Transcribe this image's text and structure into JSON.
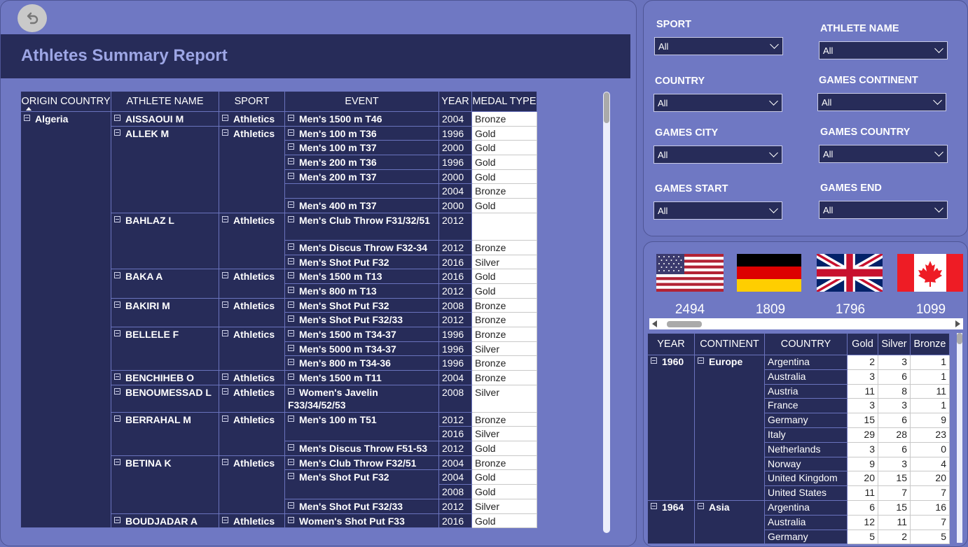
{
  "report": {
    "title": "Athletes Summary Report"
  },
  "athletes_table": {
    "columns": [
      "ORIGIN COUNTRY",
      "ATHLETE NAME",
      "SPORT",
      "EVENT",
      "YEAR",
      "MEDAL TYPE"
    ],
    "country": "Algeria",
    "groups": [
      {
        "name": "AISSAOUI M",
        "sport": "Athletics",
        "rows": [
          {
            "event": "Men's 1500 m T46",
            "year": "2004",
            "medal": "Bronze"
          }
        ]
      },
      {
        "name": "ALLEK M",
        "sport": "Athletics",
        "rows": [
          {
            "event": "Men's 100 m T36",
            "year": "1996",
            "medal": "Gold"
          },
          {
            "event": "Men's 100 m T37",
            "year": "2000",
            "medal": "Gold"
          },
          {
            "event": "Men's 200 m T36",
            "year": "1996",
            "medal": "Gold"
          },
          {
            "event": "Men's 200 m T37",
            "year": "2000",
            "medal": "Gold"
          },
          {
            "event": "",
            "year": "2004",
            "medal": "Bronze"
          },
          {
            "event": "Men's 400 m T37",
            "year": "2000",
            "medal": "Gold"
          }
        ]
      },
      {
        "name": "BAHLAZ L",
        "sport": "Athletics",
        "rows": [
          {
            "event": "Men's Club Throw F31/32/51",
            "year": "2012",
            "medal": "",
            "tall": true
          },
          {
            "event": "Men's Discus Throw F32-34",
            "year": "2012",
            "medal": "Bronze"
          },
          {
            "event": "Men's Shot Put F32",
            "year": "2016",
            "medal": "Silver"
          }
        ]
      },
      {
        "name": "BAKA A",
        "sport": "Athletics",
        "rows": [
          {
            "event": "Men's 1500 m T13",
            "year": "2016",
            "medal": "Gold"
          },
          {
            "event": "Men's 800 m T13",
            "year": "2012",
            "medal": "Gold"
          }
        ]
      },
      {
        "name": "BAKIRI M",
        "sport": "Athletics",
        "rows": [
          {
            "event": "Men's Shot Put F32",
            "year": "2008",
            "medal": "Bronze"
          },
          {
            "event": "Men's Shot Put F32/33",
            "year": "2012",
            "medal": "Bronze"
          }
        ]
      },
      {
        "name": "BELLELE F",
        "sport": "Athletics",
        "rows": [
          {
            "event": "Men's 1500 m T34-37",
            "year": "1996",
            "medal": "Bronze"
          },
          {
            "event": "Men's 5000 m T34-37",
            "year": "1996",
            "medal": "Silver"
          },
          {
            "event": "Men's 800 m T34-36",
            "year": "1996",
            "medal": "Bronze"
          }
        ]
      },
      {
        "name": "BENCHIHEB O",
        "sport": "Athletics",
        "rows": [
          {
            "event": "Men's 1500 m T11",
            "year": "2004",
            "medal": "Bronze"
          }
        ]
      },
      {
        "name": "BENOUMESSAD L",
        "sport": "Athletics",
        "rows": [
          {
            "event": "Women's Javelin F33/34/52/53",
            "year": "2008",
            "medal": "Silver",
            "tall": true
          }
        ]
      },
      {
        "name": "BERRAHAL M",
        "sport": "Athletics",
        "rows": [
          {
            "event": "Men's 100 m T51",
            "year": "2012",
            "medal": "Bronze",
            "span": 2
          },
          {
            "event": null,
            "year": "2016",
            "medal": "Silver"
          },
          {
            "event": "Men's Discus Throw F51-53",
            "year": "2012",
            "medal": "Gold"
          }
        ]
      },
      {
        "name": "BETINA K",
        "sport": "Athletics",
        "rows": [
          {
            "event": "Men's Club Throw F32/51",
            "year": "2004",
            "medal": "Bronze"
          },
          {
            "event": "Men's Shot Put F32",
            "year": "2004",
            "medal": "Gold",
            "span": 2
          },
          {
            "event": null,
            "year": "2008",
            "medal": "Gold"
          },
          {
            "event": "Men's Shot Put F32/33",
            "year": "2012",
            "medal": "Silver"
          }
        ]
      },
      {
        "name": "BOUDJADAR A",
        "sport": "Athletics",
        "rows": [
          {
            "event": "Women's Shot Put F33",
            "year": "2016",
            "medal": "Gold"
          }
        ]
      }
    ]
  },
  "filters": [
    {
      "label": "SPORT",
      "value": "All"
    },
    {
      "label": "ATHLETE NAME",
      "value": "All"
    },
    {
      "label": "COUNTRY",
      "value": "All"
    },
    {
      "label": "GAMES CONTINENT",
      "value": "All"
    },
    {
      "label": "GAMES CITY",
      "value": "All"
    },
    {
      "label": "GAMES COUNTRY",
      "value": "All"
    },
    {
      "label": "GAMES START",
      "value": "All"
    },
    {
      "label": "GAMES END",
      "value": "All"
    }
  ],
  "flags": [
    {
      "icon": "usa-flag-icon",
      "count": "2494"
    },
    {
      "icon": "germany-flag-icon",
      "count": "1809"
    },
    {
      "icon": "uk-flag-icon",
      "count": "1796"
    },
    {
      "icon": "canada-flag-icon",
      "count": "1099"
    }
  ],
  "medal_table": {
    "columns": [
      "YEAR",
      "CONTINENT",
      "COUNTRY",
      "Gold",
      "Silver",
      "Bronze"
    ],
    "groups": [
      {
        "year": "1960",
        "continent": "Europe",
        "rows": [
          [
            "Argentina",
            "2",
            "3",
            "1"
          ],
          [
            "Australia",
            "3",
            "6",
            "1"
          ],
          [
            "Austria",
            "11",
            "8",
            "11"
          ],
          [
            "France",
            "3",
            "3",
            "1"
          ],
          [
            "Germany",
            "15",
            "6",
            "9"
          ],
          [
            "Italy",
            "29",
            "28",
            "23"
          ],
          [
            "Netherlands",
            "3",
            "6",
            "0"
          ],
          [
            "Norway",
            "9",
            "3",
            "4"
          ],
          [
            "United Kingdom",
            "20",
            "15",
            "20"
          ],
          [
            "United States",
            "11",
            "7",
            "7"
          ]
        ]
      },
      {
        "year": "1964",
        "continent": "Asia",
        "rows": [
          [
            "Argentina",
            "6",
            "15",
            "16"
          ],
          [
            "Australia",
            "12",
            "11",
            "7"
          ],
          [
            "Germany",
            "5",
            "2",
            "5"
          ]
        ]
      }
    ]
  },
  "colors": {
    "dark_navy": "#272c59",
    "panel": "#6f78c3",
    "title_text": "#9da6e5"
  }
}
